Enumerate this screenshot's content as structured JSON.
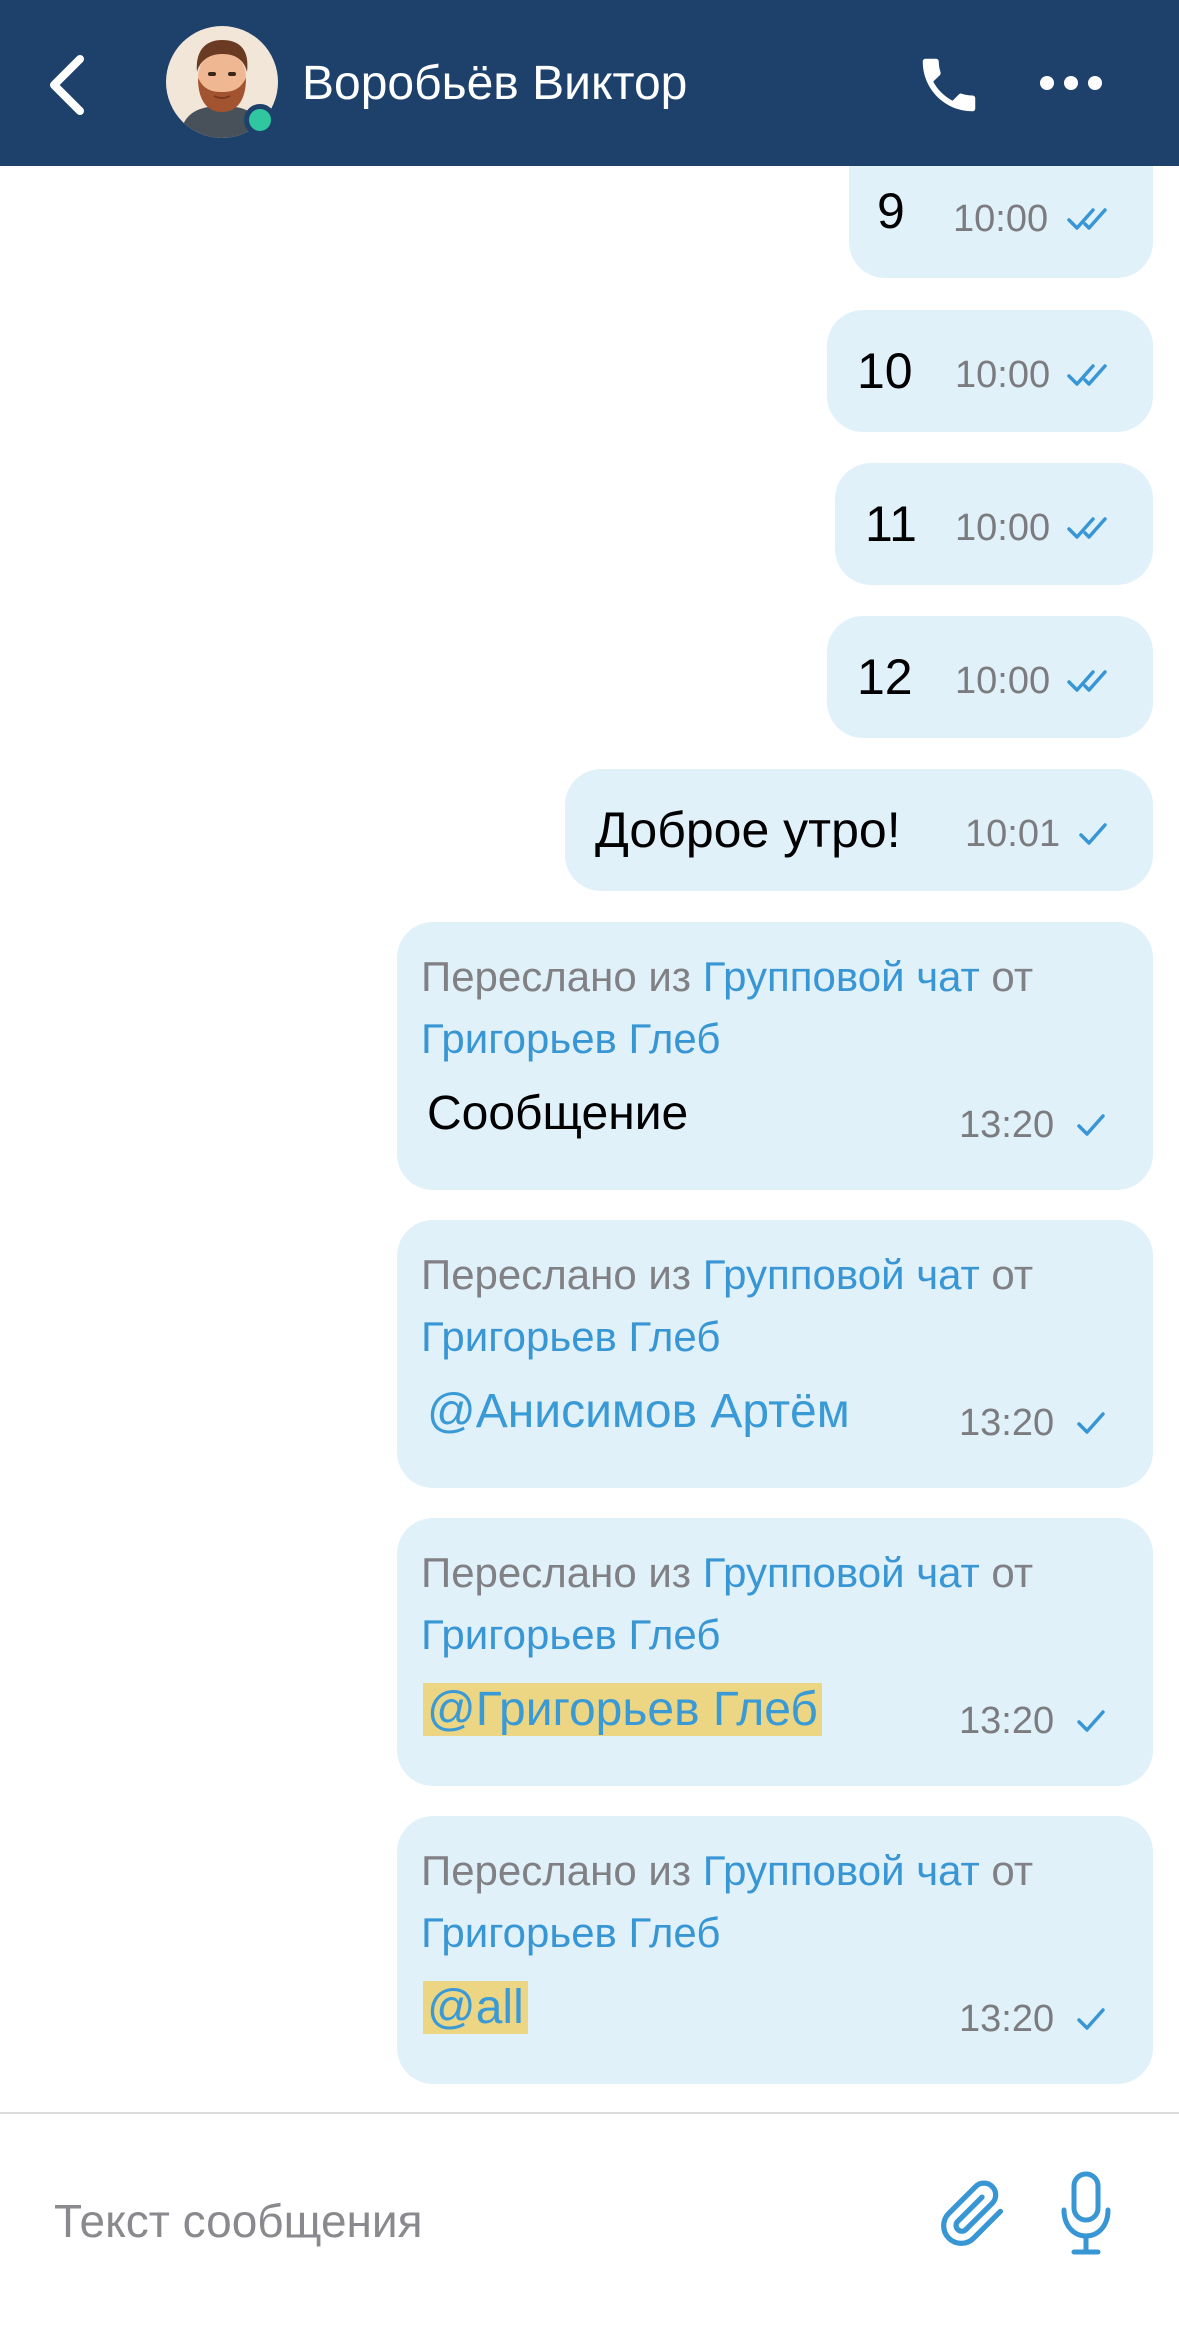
{
  "header": {
    "contact_name": "Воробьёв Виктор",
    "online": true
  },
  "messages_simple": [
    {
      "text": "9",
      "time": "10:00",
      "status": "read"
    },
    {
      "text": "10",
      "time": "10:00",
      "status": "read"
    },
    {
      "text": "11",
      "time": "10:00",
      "status": "read"
    },
    {
      "text": "12",
      "time": "10:00",
      "status": "read"
    },
    {
      "text": "Доброе утро!",
      "time": "10:01",
      "status": "sent"
    }
  ],
  "forwarded": [
    {
      "prefix": "Переслано из ",
      "chat": "Групповой чат",
      "from_word": " от",
      "author": "Григорьев Глеб",
      "body": "Сообщение",
      "time": "13:20",
      "status": "sent"
    },
    {
      "prefix": "Переслано из ",
      "chat": "Групповой чат",
      "from_word": " от",
      "author": "Григорьев Глеб",
      "body": "@Анисимов Артём",
      "time": "13:20",
      "status": "sent"
    },
    {
      "prefix": "Переслано из ",
      "chat": "Групповой чат",
      "from_word": " от",
      "author": "Григорьев Глеб",
      "body": "@Григорьев Глеб",
      "time": "13:20",
      "status": "sent"
    },
    {
      "prefix": "Переслано из ",
      "chat": "Групповой чат",
      "from_word": " от",
      "author": "Григорьев Глеб",
      "body": "@all",
      "time": "13:20",
      "status": "sent"
    }
  ],
  "composer": {
    "placeholder": "Текст сообщения"
  },
  "icons": {
    "back": "chevron-left-icon",
    "call": "phone-icon",
    "more": "more-horizontal-icon",
    "attach": "paperclip-icon",
    "mic": "microphone-icon",
    "read": "double-check-icon",
    "sent": "single-check-icon"
  },
  "colors": {
    "header_bg": "#1e416b",
    "bubble_bg": "#e0f1fa",
    "link": "#3996d5",
    "online": "#2fc6a0",
    "highlight": "#ecd683"
  }
}
